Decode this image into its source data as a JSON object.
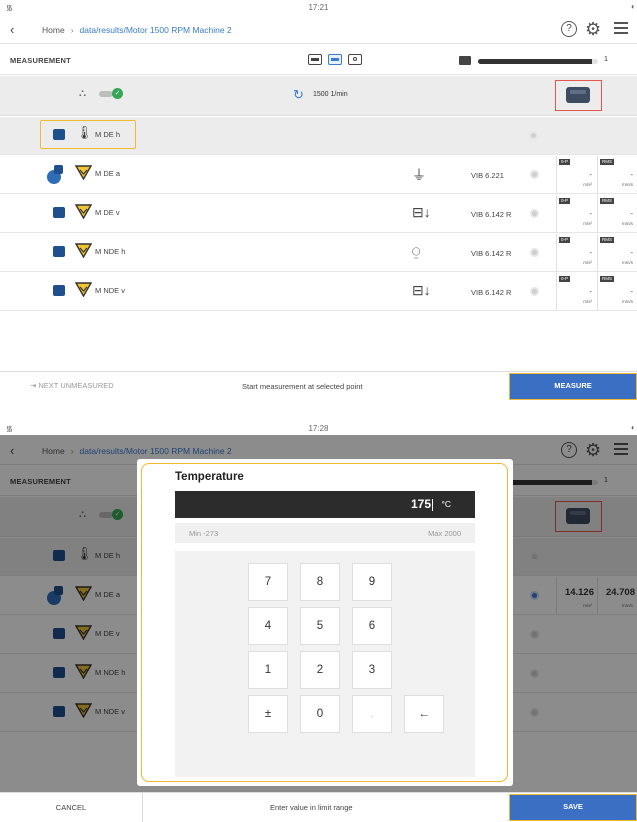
{
  "screen1": {
    "status": {
      "time": "17:21"
    },
    "nav": {
      "home": "Home",
      "path": "data/results/Motor 1500 RPM Machine 2"
    },
    "header": {
      "title": "MEASUREMENT",
      "progress_fraction": 0.95,
      "progress_count": "1"
    },
    "machine_row": {
      "speed": "1500 1/min"
    },
    "rows": [
      {
        "name": "M DE h",
        "device": "",
        "sensor": "",
        "selected": true,
        "value_rms": ""
      },
      {
        "name": "M DE a",
        "device": "axial",
        "sensor": "VIB 6.221",
        "selected": false,
        "value_rms": "-"
      },
      {
        "name": "M DE v",
        "device": "vertical",
        "sensor": "VIB 6.142 R",
        "selected": false,
        "value_rms": "-"
      },
      {
        "name": "M NDE h",
        "device": "horizontal",
        "sensor": "VIB 6.142 R",
        "selected": false,
        "value_rms": "-"
      },
      {
        "name": "M NDE v",
        "device": "vertical",
        "sensor": "VIB 6.142 R",
        "selected": false,
        "value_rms": "-"
      }
    ],
    "value_tags": {
      "peak": "0-P",
      "rms": "RMS"
    },
    "units": {
      "accel": "m/s²",
      "vel": "mm/s"
    },
    "footer": {
      "left": "NEXT UNMEASURED",
      "message": "Start measurement at selected point",
      "primary": "MEASURE"
    }
  },
  "screen2": {
    "status": {
      "time": "17:28"
    },
    "nav": {
      "home": "Home",
      "path": "data/results/Motor 1500 RPM Machine 2"
    },
    "header": {
      "title": "MEASUREMENT",
      "progress_count": "1"
    },
    "rows": [
      {
        "name": "M DE h"
      },
      {
        "name": "M DE a",
        "value_peak": "14.126",
        "value_rms": "24.708"
      },
      {
        "name": "M DE v"
      },
      {
        "name": "M NDE h"
      },
      {
        "name": "M NDE v"
      }
    ],
    "dialog": {
      "title": "Temperature",
      "value": "175",
      "unit": "°C",
      "min": "Min -273",
      "max": "Max 2000",
      "keys": [
        "7",
        "8",
        "9",
        "4",
        "5",
        "6",
        "1",
        "2",
        "3",
        "±",
        "0",
        ".",
        "←"
      ]
    },
    "footer": {
      "cancel": "CANCEL",
      "message": "Enter value in limit range",
      "primary": "SAVE"
    }
  },
  "colors": {
    "accent": "#3b6fc4",
    "highlight": "#f0b92e",
    "alert_box": "#e5574d",
    "ok": "#33a852"
  }
}
